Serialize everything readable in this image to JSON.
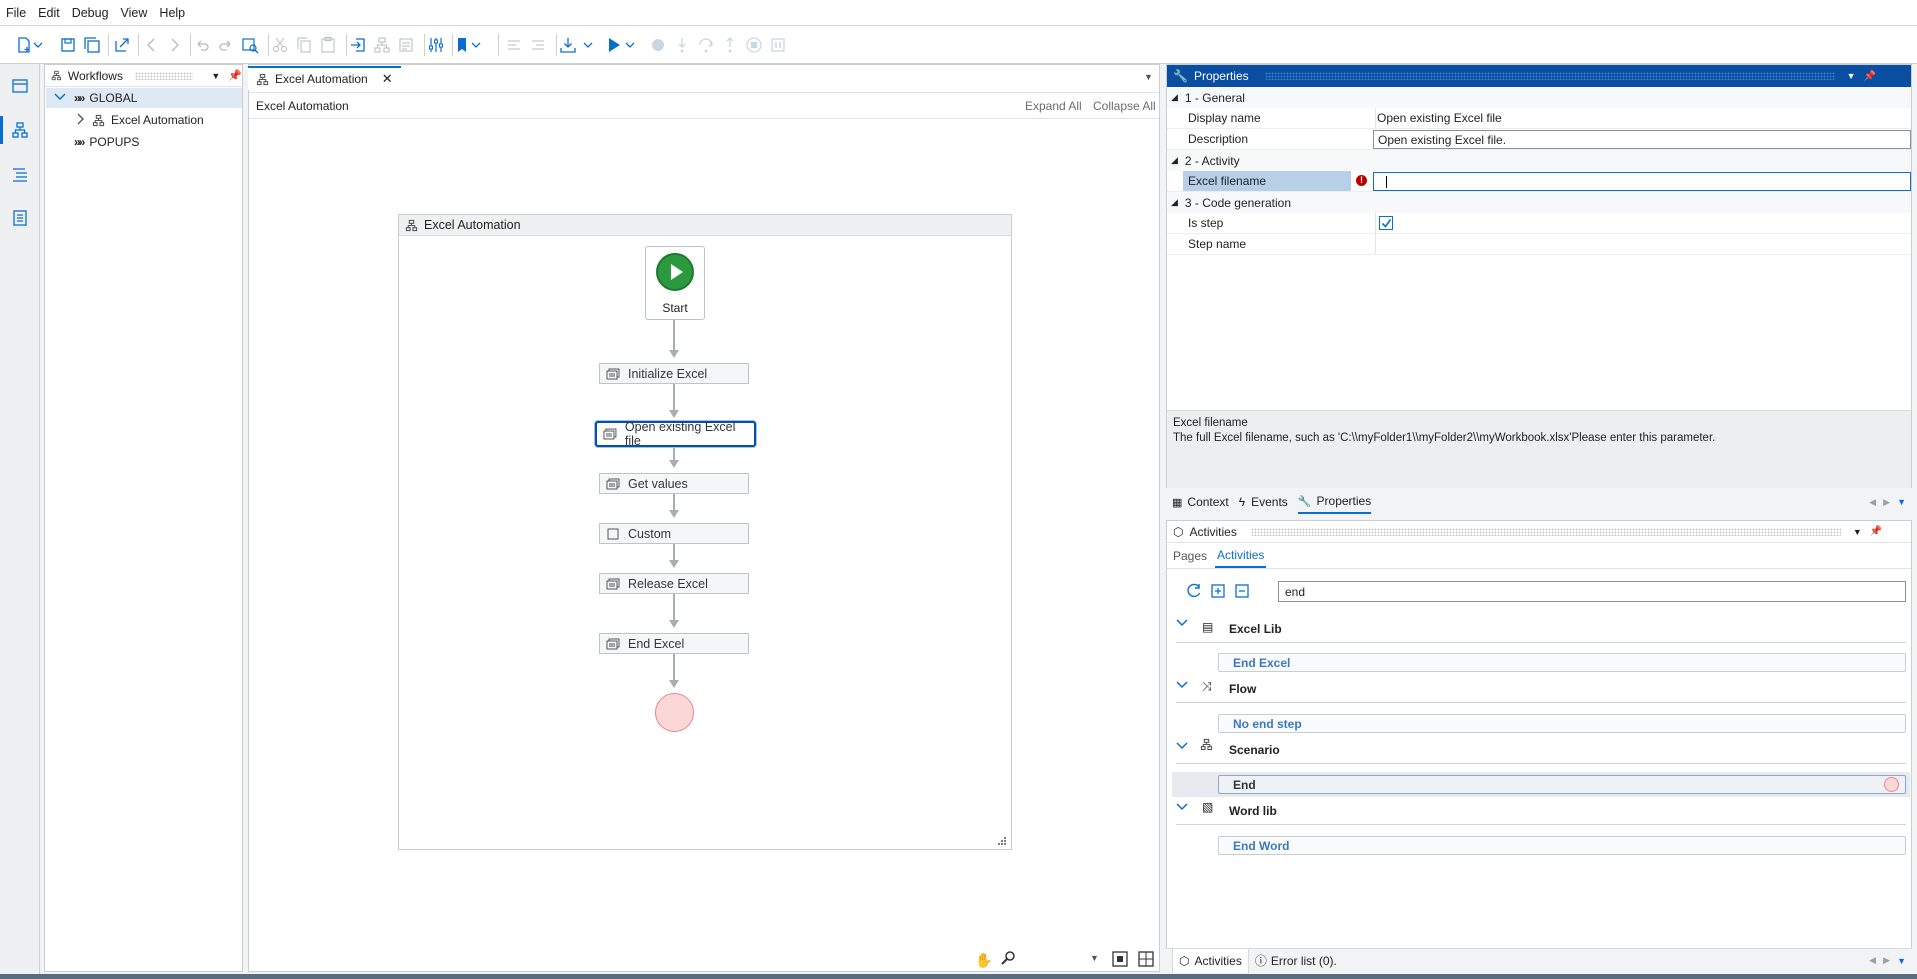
{
  "menu": [
    "File",
    "Edit",
    "Debug",
    "View",
    "Help"
  ],
  "workflows_panel": {
    "title": "Workflows",
    "tree": [
      {
        "label": "GLOBAL",
        "expanded": true
      },
      {
        "label": "Excel Automation",
        "expanded": false
      },
      {
        "label": "POPUPS"
      }
    ]
  },
  "editor": {
    "tab_label": "Excel Automation",
    "breadcrumb": "Excel Automation",
    "expand_all": "Expand All",
    "collapse_all": "Collapse All",
    "canvas_title": "Excel Automation",
    "start_label": "Start",
    "steps": [
      "Initialize Excel",
      "Open existing Excel file",
      "Get values",
      "Custom",
      "Release Excel",
      "End Excel"
    ],
    "selected_step": "Open existing Excel file"
  },
  "properties": {
    "title": "Properties",
    "categories": {
      "general": "1 - General",
      "activity": "2 - Activity",
      "codegen": "3 - Code generation"
    },
    "rows": {
      "display_name_label": "Display name",
      "display_name_value": "Open existing Excel file",
      "description_label": "Description",
      "description_value": "Open existing Excel file.",
      "excel_filename_label": "Excel filename",
      "excel_filename_value": "",
      "is_step_label": "Is step",
      "is_step_checked": true,
      "step_name_label": "Step name",
      "step_name_value": ""
    },
    "help_title": "Excel filename",
    "help_text": "The full Excel filename, such as  'C:\\\\myFolder1\\\\myFolder2\\\\myWorkbook.xlsx'Please enter this parameter."
  },
  "side_tabs": [
    "Context",
    "Events",
    "Properties"
  ],
  "activities_panel": {
    "title": "Activities",
    "subtabs": [
      "Pages",
      "Activities"
    ],
    "search_value": "end",
    "groups": [
      {
        "name": "Excel Lib",
        "items": [
          "End Excel"
        ]
      },
      {
        "name": "Flow",
        "items": [
          "No end step"
        ]
      },
      {
        "name": "Scenario",
        "items": [
          "End"
        ]
      },
      {
        "name": "Word lib",
        "items": [
          "End Word"
        ]
      }
    ]
  },
  "bottom_tabs": [
    "Activities",
    "Error list (0)."
  ],
  "colors": {
    "accent": "#0a6ed1",
    "start_green": "#2b9a3f",
    "end_fill": "#fbd7d7",
    "end_stroke": "#e8868a",
    "error_red": "#bb0000",
    "link_blue": "#3a79c0"
  }
}
